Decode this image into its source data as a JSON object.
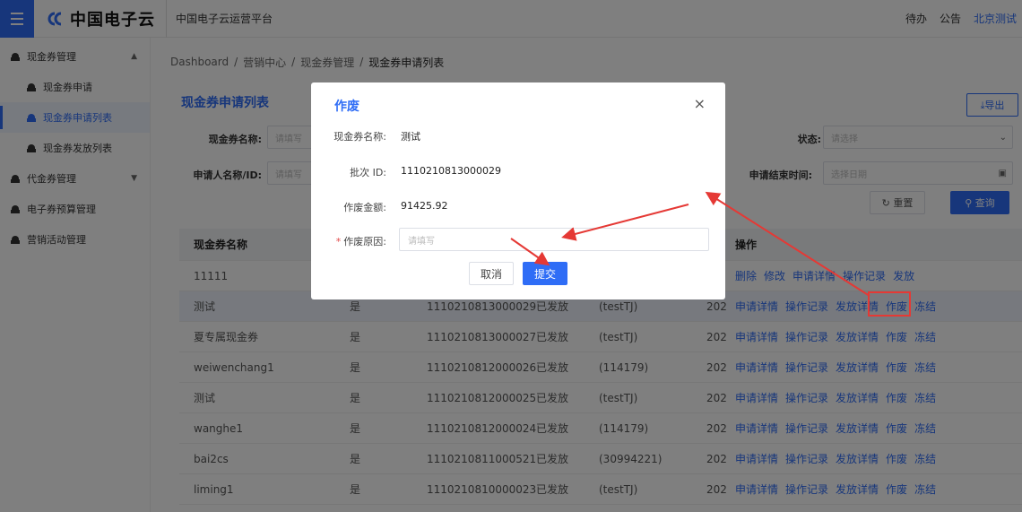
{
  "header": {
    "logo_text": "中国电子云",
    "platform": "中国电子云运营平台",
    "todo": "待办",
    "notice": "公告",
    "user": "北京测试"
  },
  "sidebar": {
    "items": [
      {
        "label": "现金券管理",
        "arrow": "▲"
      },
      {
        "label": "现金券申请"
      },
      {
        "label": "现金券申请列表"
      },
      {
        "label": "现金券发放列表"
      },
      {
        "label": "代金券管理",
        "arrow": "▼"
      },
      {
        "label": "电子券预算管理"
      },
      {
        "label": "营销活动管理"
      }
    ]
  },
  "breadcrumb": {
    "items": [
      "Dashboard",
      "营销中心",
      "现金券管理",
      "现金券申请列表"
    ],
    "sep": "/"
  },
  "page": {
    "title": "现金券申请列表",
    "export": "⤓导出"
  },
  "filters": {
    "name_label": "现金券名称:",
    "name_placeholder": "请填写",
    "applicant_label": "申请人名称/ID:",
    "applicant_placeholder": "请填写",
    "status_label": "状态:",
    "status_placeholder": "请选择",
    "end_label": "申请结束时间:",
    "end_placeholder": "选择日期",
    "reset": "↻ 重置",
    "search": "⚲ 查询"
  },
  "table": {
    "header": {
      "name": "现金券名称",
      "ops": "操作"
    },
    "rows": [
      {
        "name": "11111",
        "flag": "",
        "batch": "",
        "status": "",
        "user": "",
        "date": "",
        "ops": [
          "删除",
          "修改",
          "申请详情",
          "操作记录",
          "发放"
        ]
      },
      {
        "name": "测试",
        "flag": "是",
        "batch": "1110210813000029",
        "status": "已发放",
        "user": "(testTJ)",
        "date": "202",
        "ops": [
          "申请详情",
          "操作记录",
          "发放详情",
          "作废",
          "冻结"
        ]
      },
      {
        "name": "夏专属现金券",
        "flag": "是",
        "batch": "1110210813000027",
        "status": "已发放",
        "user": "(testTJ)",
        "date": "202",
        "ops": [
          "申请详情",
          "操作记录",
          "发放详情",
          "作废",
          "冻结"
        ]
      },
      {
        "name": "weiwenchang1",
        "flag": "是",
        "batch": "1110210812000026",
        "status": "已发放",
        "user": "(114179)",
        "date": "202",
        "ops": [
          "申请详情",
          "操作记录",
          "发放详情",
          "作废",
          "冻结"
        ]
      },
      {
        "name": "测试",
        "flag": "是",
        "batch": "1110210812000025",
        "status": "已发放",
        "user": "(testTJ)",
        "date": "202",
        "ops": [
          "申请详情",
          "操作记录",
          "发放详情",
          "作废",
          "冻结"
        ]
      },
      {
        "name": "wanghe1",
        "flag": "是",
        "batch": "1110210812000024",
        "status": "已发放",
        "user": "(114179)",
        "date": "202",
        "ops": [
          "申请详情",
          "操作记录",
          "发放详情",
          "作废",
          "冻结"
        ]
      },
      {
        "name": "bai2cs",
        "flag": "是",
        "batch": "1110210811000521",
        "status": "已发放",
        "user": "(30994221)",
        "date": "202",
        "ops": [
          "申请详情",
          "操作记录",
          "发放详情",
          "作废",
          "冻结"
        ]
      },
      {
        "name": "liming1",
        "flag": "是",
        "batch": "1110210810000023",
        "status": "已发放",
        "user": "(testTJ)",
        "date": "202",
        "ops": [
          "申请详情",
          "操作记录",
          "发放详情",
          "作废",
          "冻结"
        ]
      }
    ]
  },
  "modal": {
    "title": "作废",
    "close": "×",
    "name_label": "现金券名称:",
    "name_value": "测试",
    "batch_label": "批次 ID:",
    "batch_value": "1110210813000029",
    "amount_label": "作废金额:",
    "amount_value": "91425.92",
    "reason_label": "作废原因:",
    "reason_required": "*",
    "reason_placeholder": "请填写",
    "cancel": "取消",
    "submit": "提交"
  },
  "colors": {
    "accent": "#2f6df6",
    "annotation": "#e53935"
  }
}
